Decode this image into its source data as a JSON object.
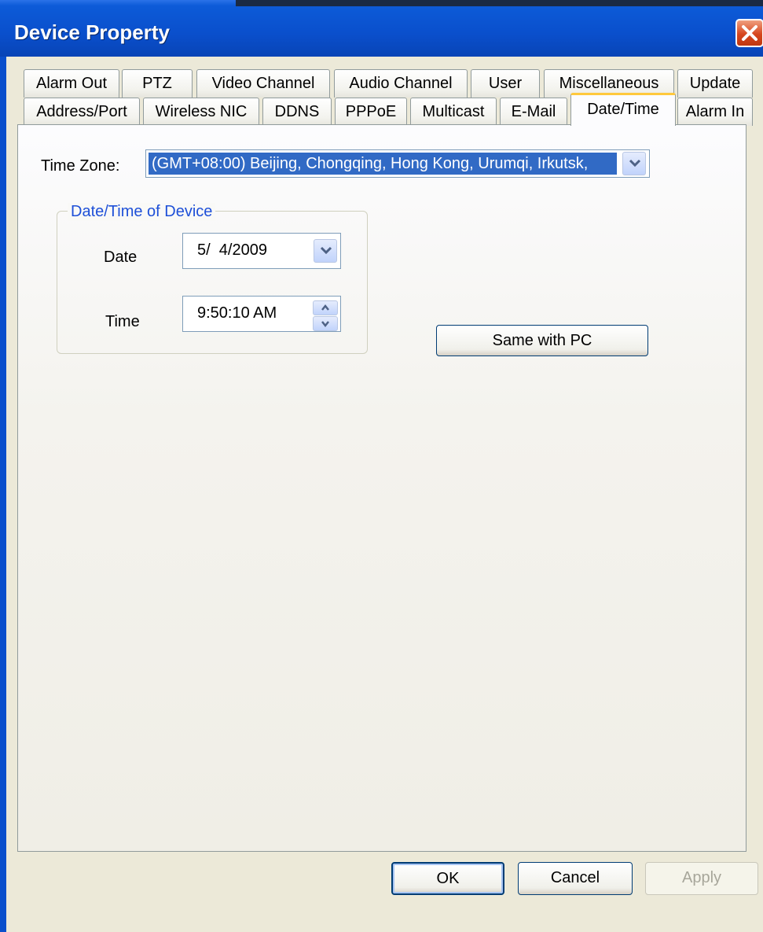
{
  "window": {
    "title": "Device Property"
  },
  "tabs_row1": [
    "Alarm Out",
    "PTZ",
    "Video Channel",
    "Audio Channel",
    "User",
    "Miscellaneous",
    "Update"
  ],
  "tabs_row2": [
    "Address/Port",
    "Wireless NIC",
    "DDNS",
    "PPPoE",
    "Multicast",
    "E-Mail",
    "Date/Time",
    "Alarm In"
  ],
  "selected_tab": "Date/Time",
  "time_zone": {
    "label": "Time Zone:",
    "value": "(GMT+08:00) Beijing, Chongqing, Hong Kong, Urumqi, Irkutsk,"
  },
  "group": {
    "title": "Date/Time of Device",
    "date_label": "Date",
    "date_value": "5/  4/2009",
    "time_label": "Time",
    "time_value": "9:50:10 AM"
  },
  "same_with_pc_label": "Same with PC",
  "footer": {
    "ok_label": "OK",
    "cancel_label": "Cancel",
    "apply_label": "Apply"
  },
  "colors": {
    "titlebar": "#0a4fcc",
    "selection": "#316ac5",
    "group_title": "#1e50d8",
    "selected_tab_accent": "#ffc83c"
  }
}
